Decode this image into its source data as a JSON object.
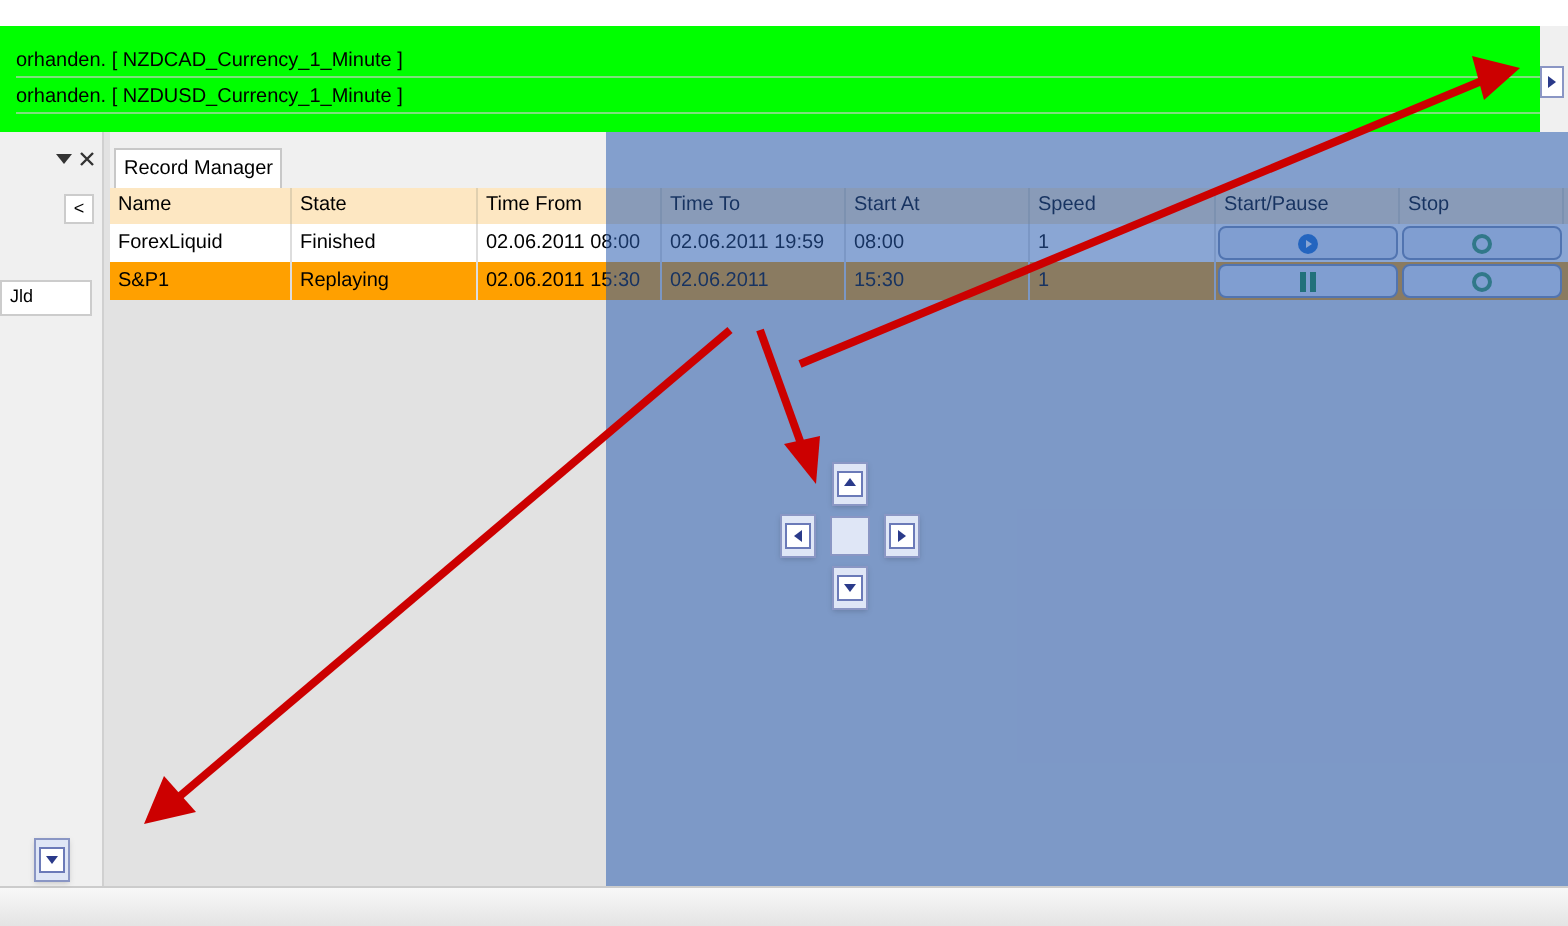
{
  "log_rows": [
    {
      "text": "orhanden. [ NZDCAD_Currency_1_Minute ]"
    },
    {
      "text": "orhanden. [ NZDUSD_Currency_1_Minute ]"
    }
  ],
  "left_panel": {
    "collapse_button": "<",
    "button_label": "Jld"
  },
  "tabs": [
    {
      "label": "Record Manager",
      "selected": true
    }
  ],
  "table": {
    "columns": [
      "Name",
      "State",
      "Time From",
      "Time To",
      "Start At",
      "Speed",
      "Start/Pause",
      "Stop"
    ],
    "rows": [
      {
        "name": "ForexLiquid",
        "state": "Finished",
        "time_from": "02.06.2011 08:00",
        "time_to": "02.06.2011 19:59",
        "start_at": "08:00",
        "speed": "1",
        "kind": "play",
        "selected": false
      },
      {
        "name": "S&P1",
        "state": "Replaying",
        "time_from": "02.06.2011 15:30",
        "time_to": "02.06.2011",
        "start_at": "15:30",
        "speed": "1",
        "kind": "pause",
        "selected": true
      }
    ]
  }
}
